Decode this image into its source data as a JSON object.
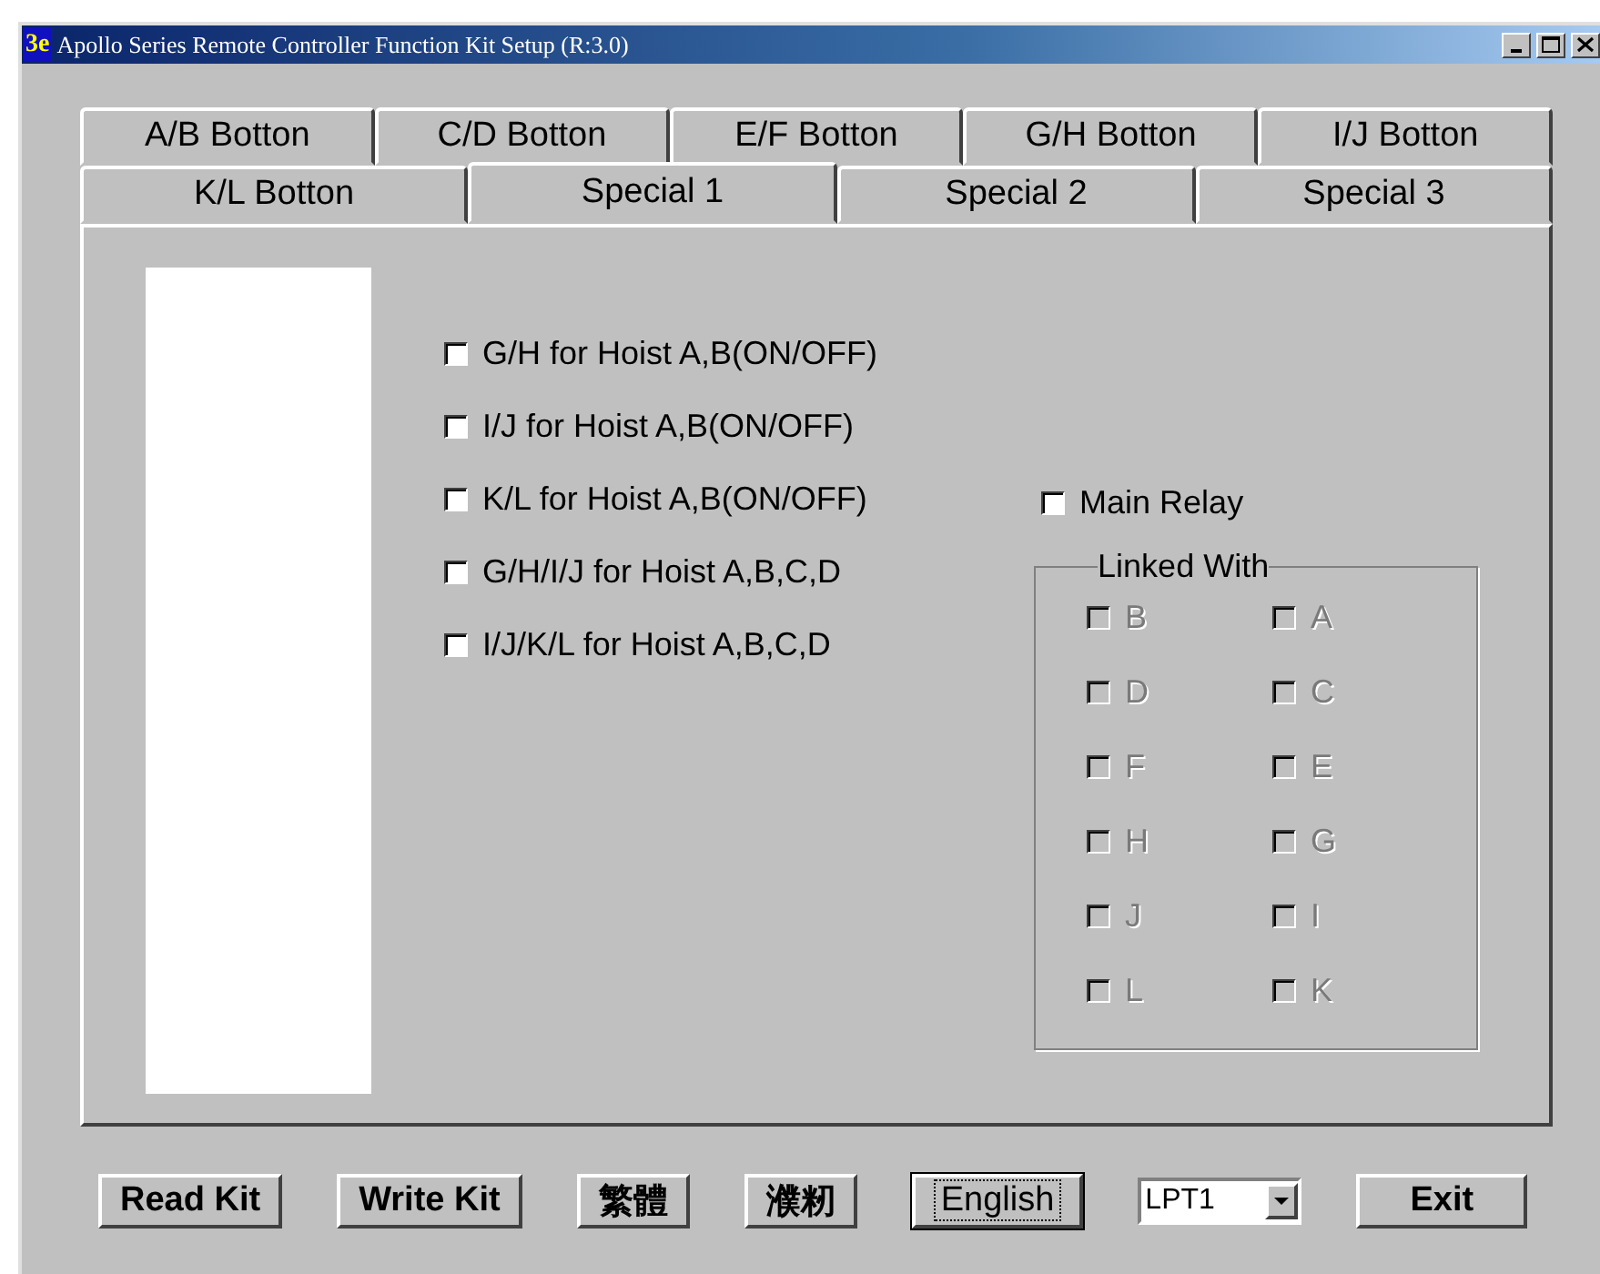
{
  "window": {
    "title": "Apollo Series Remote Controller Function Kit Setup (R:3.0)",
    "logo": "3e"
  },
  "tab_rows": [
    [
      {
        "label": "A/B Botton",
        "selected": false
      },
      {
        "label": "C/D Botton",
        "selected": false
      },
      {
        "label": "E/F Botton",
        "selected": false
      },
      {
        "label": "G/H Botton",
        "selected": false
      },
      {
        "label": "I/J Botton",
        "selected": false
      }
    ],
    [
      {
        "label": "K/L Botton",
        "selected": false
      },
      {
        "label": "Special 1",
        "selected": true
      },
      {
        "label": "Special 2",
        "selected": false
      },
      {
        "label": "Special 3",
        "selected": false
      }
    ]
  ],
  "options": [
    {
      "label": "G/H for Hoist A,B(ON/OFF)",
      "checked": false
    },
    {
      "label": "I/J for Hoist A,B(ON/OFF)",
      "checked": false
    },
    {
      "label": "K/L for Hoist A,B(ON/OFF)",
      "checked": false
    },
    {
      "label": "G/H/I/J for Hoist A,B,C,D",
      "checked": false
    },
    {
      "label": "I/J/K/L for Hoist A,B,C,D",
      "checked": false
    }
  ],
  "main_relay": {
    "label": "Main Relay",
    "checked": false
  },
  "linked_with": {
    "title": "Linked With",
    "items": [
      {
        "label": "B",
        "checked": false,
        "disabled": true
      },
      {
        "label": "A",
        "checked": false,
        "disabled": true
      },
      {
        "label": "D",
        "checked": false,
        "disabled": true
      },
      {
        "label": "C",
        "checked": false,
        "disabled": true
      },
      {
        "label": "F",
        "checked": false,
        "disabled": true
      },
      {
        "label": "E",
        "checked": false,
        "disabled": true
      },
      {
        "label": "H",
        "checked": false,
        "disabled": true
      },
      {
        "label": "G",
        "checked": false,
        "disabled": true
      },
      {
        "label": "J",
        "checked": false,
        "disabled": true
      },
      {
        "label": "I",
        "checked": false,
        "disabled": true
      },
      {
        "label": "L",
        "checked": false,
        "disabled": true
      },
      {
        "label": "K",
        "checked": false,
        "disabled": true
      }
    ]
  },
  "buttons": [
    {
      "label": "Read Kit",
      "kind": "button",
      "focused": false
    },
    {
      "label": "Write Kit",
      "kind": "button",
      "focused": false
    },
    {
      "label": "繁體",
      "kind": "button",
      "focused": false
    },
    {
      "label": "濮籾",
      "kind": "button",
      "focused": false
    },
    {
      "label": "English",
      "kind": "button",
      "focused": true
    },
    {
      "label": "LPT1",
      "kind": "dropdown"
    },
    {
      "label": "Exit",
      "kind": "button",
      "focused": false
    }
  ]
}
